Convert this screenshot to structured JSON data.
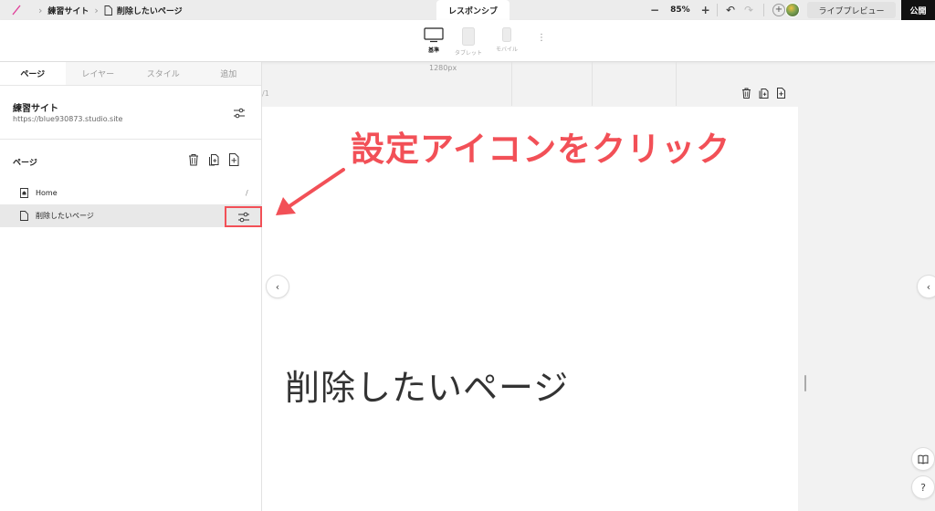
{
  "topbar": {
    "site_name": "練習サイト",
    "page_name": "削除したいページ",
    "responsive_tab": "レスポンシブ",
    "zoom_minus": "−",
    "zoom_level": "85%",
    "zoom_plus": "+",
    "preview_label": "ライブプレビュー",
    "publish_label": "公開"
  },
  "devices": {
    "items": [
      {
        "label": "基準",
        "icon": "desktop-icon"
      },
      {
        "label": "タブレット",
        "icon": "tablet-icon"
      },
      {
        "label": "モバイル",
        "icon": "mobile-icon"
      }
    ],
    "width_label": "1280px"
  },
  "canvas": {
    "page_path": "/1",
    "heading": "削除したいページ"
  },
  "panel": {
    "tabs": [
      {
        "label": "ページ",
        "active": true
      },
      {
        "label": "レイヤー",
        "active": false
      },
      {
        "label": "スタイル",
        "active": false
      },
      {
        "label": "追加",
        "active": false
      }
    ],
    "site_name": "練習サイト",
    "site_url": "https://blue930873.studio.site",
    "pages_heading": "ページ",
    "pages": [
      {
        "label": "Home",
        "path": "/",
        "icon": "home-page-icon"
      },
      {
        "label": "削除したいページ",
        "path": "",
        "icon": "page-icon",
        "selected": true
      }
    ]
  },
  "annotation": {
    "text": "設定アイコンをクリック",
    "color": "#f25057"
  },
  "colors": {
    "accent": "#f25057",
    "publish": "#111111"
  }
}
